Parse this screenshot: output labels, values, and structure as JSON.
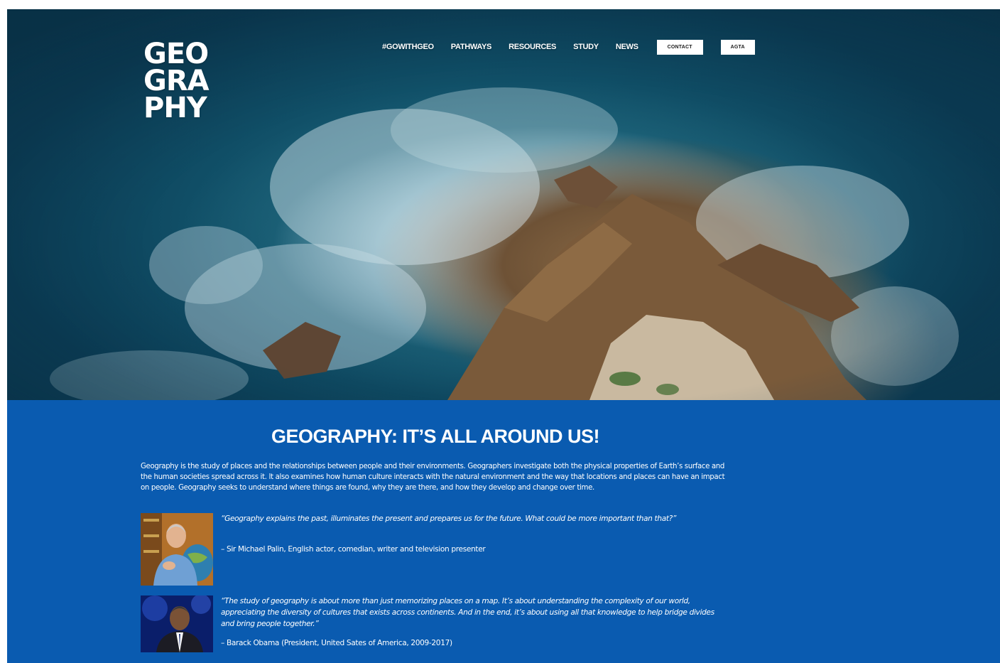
{
  "logo": {
    "line1": "GEO",
    "line2": "GRA",
    "line3": "PHY"
  },
  "nav": {
    "items": [
      {
        "label": "#GOWITHGEO"
      },
      {
        "label": "PATHWAYS"
      },
      {
        "label": "RESOURCES"
      },
      {
        "label": "STUDY"
      },
      {
        "label": "NEWS"
      }
    ],
    "contact_label": "CONTACT",
    "agta_label": "AGTA"
  },
  "main": {
    "heading": "GEOGRAPHY: IT’S ALL AROUND US!",
    "intro": "Geography is the study of places and the relationships between people and their environments. Geographers investigate both the physical properties of Earth’s surface and the human societies spread across it. It also examines how human culture interacts with the natural environment and the way that locations and places can have an impact on people. Geography seeks to understand where things are found, why they are there, and how they develop and change over time.",
    "quotes": [
      {
        "text": "“Geography explains the past, illuminates the present and prepares us for the future. What could be more important than that?”",
        "author": "– Sir Michael Palin, English actor, comedian, writer and television presenter"
      },
      {
        "text": "“The study of geography is about more than just memorizing places on a map. It’s about understanding the complexity of our world, appreciating the diversity of cultures that exists across continents. And in the end, it’s about using all that knowledge to help bridge divides and bring people together.”",
        "author": "– Barack Obama (President, United Sates of America, 2009-2017)"
      }
    ]
  },
  "colors": {
    "section_blue": "#0a5bb0",
    "ocean": "#0b3a52",
    "nav_text": "#ffffff"
  }
}
